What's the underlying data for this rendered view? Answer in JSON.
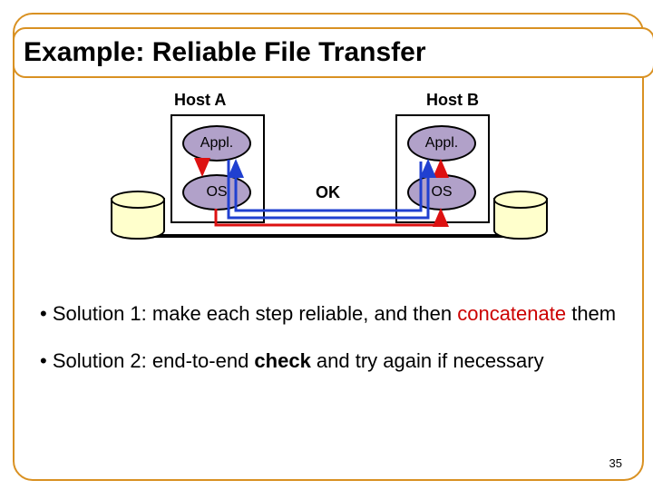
{
  "title": "Example: Reliable File Transfer",
  "hostA": {
    "label": "Host A",
    "appl": "Appl.",
    "os": "OS"
  },
  "hostB": {
    "label": "Host B",
    "appl": "Appl.",
    "os": "OS"
  },
  "ok": "OK",
  "bullet1_pre": "• Solution 1: make each step reliable, and then ",
  "bullet1_red": "concatenate",
  "bullet1_post": " them",
  "bullet2_pre": "• Solution 2: end-to-end ",
  "bullet2_bold": "check",
  "bullet2_post": " and try again if necessary",
  "slide_num": "35"
}
